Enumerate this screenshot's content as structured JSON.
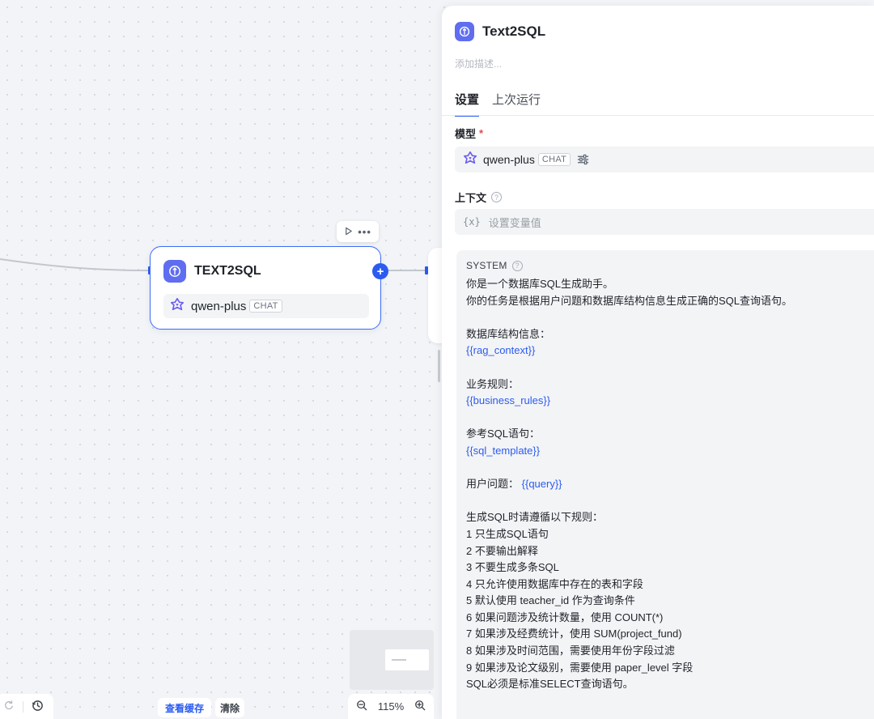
{
  "canvas": {
    "node": {
      "title": "TEXT2SQL",
      "model_name": "qwen-plus",
      "model_badge": "CHAT"
    },
    "toolbar": {
      "run_icon": "play-icon",
      "more_icon": "ellipsis-icon"
    },
    "bottom": {
      "view_cache_label": "查看缓存",
      "clear_label": "清除",
      "zoom_level": "115%"
    }
  },
  "panel": {
    "title": "Text2SQL",
    "description_placeholder": "添加描述...",
    "tabs": [
      {
        "label": "设置",
        "active": true
      },
      {
        "label": "上次运行",
        "active": false
      }
    ],
    "model_label": "模型",
    "model_required": "*",
    "model_name": "qwen-plus",
    "model_badge": "CHAT",
    "context_label": "上下文",
    "context_placeholder": "设置变量值",
    "context_var_icon": "{x}",
    "system_label": "SYSTEM",
    "prompt": {
      "intro1": "你是一个数据库SQL生成助手。",
      "intro2": "你的任务是根据用户问题和数据库结构信息生成正确的SQL查询语句。",
      "schema_label": "数据库结构信息：",
      "schema_var": "{{rag_context}}",
      "rules_label": "业务规则：",
      "rules_var": "{{business_rules}}",
      "ref_label": "参考SQL语句：",
      "ref_var": "{{sql_template}}",
      "question_label": "用户问题：",
      "question_var": "{{query}}",
      "gen_label": "生成SQL时请遵循以下规则：",
      "r1": "1 只生成SQL语句",
      "r2": "2 不要输出解释",
      "r3": "3 不要生成多条SQL",
      "r4": "4 只允许使用数据库中存在的表和字段",
      "r5": "5 默认使用 teacher_id 作为查询条件",
      "r6": "6 如果问题涉及统计数量，使用 COUNT(*)",
      "r7": "7 如果涉及经费统计，使用 SUM(project_fund)",
      "r8": "8 如果涉及时间范围，需要使用年份字段过滤",
      "r9": "9 如果涉及论文级别，需要使用 paper_level 字段",
      "final": "SQL必须是标准SELECT查询语句。"
    }
  },
  "colors": {
    "accent": "#2b5bf0",
    "node_icon": "#5f6df0",
    "required": "#e5484d"
  }
}
